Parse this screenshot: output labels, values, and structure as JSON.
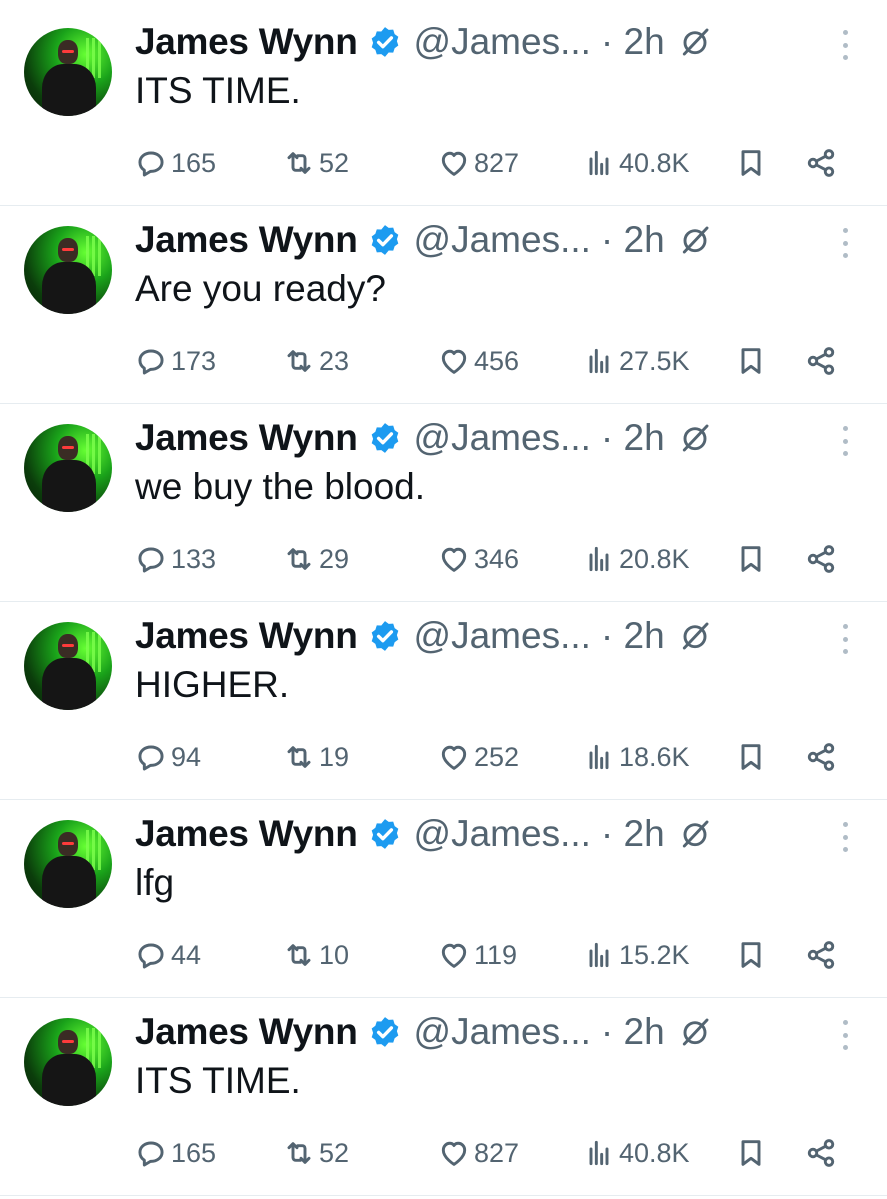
{
  "tweets": [
    {
      "name": "James Wynn",
      "handle": "@James...",
      "time": "· 2h",
      "text": "ITS TIME.",
      "replies": "165",
      "retweets": "52",
      "likes": "827",
      "views": "40.8K"
    },
    {
      "name": "James Wynn",
      "handle": "@James...",
      "time": "· 2h",
      "text": "Are you ready?",
      "replies": "173",
      "retweets": "23",
      "likes": "456",
      "views": "27.5K"
    },
    {
      "name": "James Wynn",
      "handle": "@James...",
      "time": "· 2h",
      "text": "we buy the blood.",
      "replies": "133",
      "retweets": "29",
      "likes": "346",
      "views": "20.8K"
    },
    {
      "name": "James Wynn",
      "handle": "@James...",
      "time": "· 2h",
      "text": "HIGHER.",
      "replies": "94",
      "retweets": "19",
      "likes": "252",
      "views": "18.6K"
    },
    {
      "name": "James Wynn",
      "handle": "@James...",
      "time": "· 2h",
      "text": "lfg",
      "replies": "44",
      "retweets": "10",
      "likes": "119",
      "views": "15.2K"
    },
    {
      "name": "James Wynn",
      "handle": "@James...",
      "time": "· 2h",
      "text": "ITS TIME.",
      "replies": "165",
      "retweets": "52",
      "likes": "827",
      "views": "40.8K"
    }
  ],
  "colors": {
    "verified": "#1d9bf0",
    "muted": "#536471",
    "divider": "#e6ecf0"
  },
  "icons": {
    "reply": "reply-icon",
    "retweet": "retweet-icon",
    "like": "heart-icon",
    "views": "views-icon",
    "bookmark": "bookmark-icon",
    "share": "share-icon",
    "grok": "grok-icon",
    "more": "more-options-icon",
    "verified": "verified-badge-icon"
  }
}
